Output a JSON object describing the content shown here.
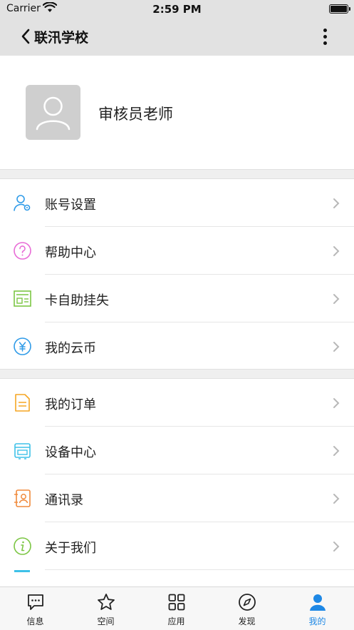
{
  "status_bar": {
    "carrier": "Carrier",
    "time": "2:59 PM"
  },
  "nav": {
    "title": "联汛学校",
    "back_icon": "chevron-left-icon",
    "more_icon": "more-vertical-icon"
  },
  "profile": {
    "name": "审核员老师",
    "avatar_icon": "user-avatar-icon"
  },
  "menu_group_1": [
    {
      "label": "账号设置",
      "icon": "user-settings-icon",
      "color": "#2f9be8"
    },
    {
      "label": "帮助中心",
      "icon": "help-icon",
      "color": "#e86bd6"
    },
    {
      "label": "卡自助挂失",
      "icon": "card-lock-icon",
      "color": "#7cc644"
    },
    {
      "label": "我的云币",
      "icon": "yen-coin-icon",
      "color": "#2f9be8"
    }
  ],
  "menu_group_2": [
    {
      "label": "我的订单",
      "icon": "order-document-icon",
      "color": "#f5a623"
    },
    {
      "label": "设备中心",
      "icon": "device-icon",
      "color": "#3ec1e8"
    },
    {
      "label": "通讯录",
      "icon": "contacts-icon",
      "color": "#f08a3c"
    },
    {
      "label": "关于我们",
      "icon": "info-icon",
      "color": "#7cc644"
    }
  ],
  "tabs": [
    {
      "label": "信息",
      "icon": "message-icon"
    },
    {
      "label": "空间",
      "icon": "star-icon"
    },
    {
      "label": "应用",
      "icon": "apps-grid-icon"
    },
    {
      "label": "发现",
      "icon": "compass-icon"
    },
    {
      "label": "我的",
      "icon": "person-icon",
      "active": true
    }
  ],
  "colors": {
    "accent": "#1e88e5",
    "nav_background": "#e2e2e2"
  }
}
